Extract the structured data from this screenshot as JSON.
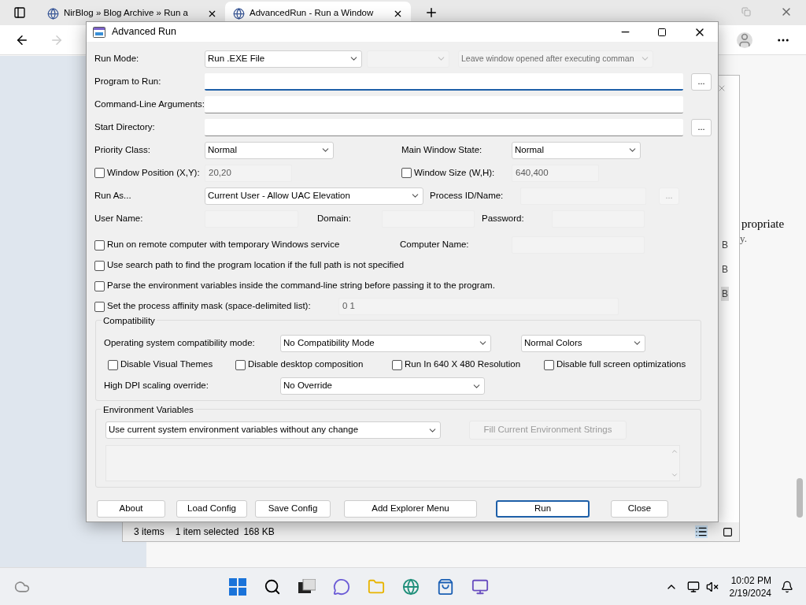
{
  "browser": {
    "tabs": [
      {
        "title": "NirBlog » Blog Archive » Run a",
        "selected": false
      },
      {
        "title": "AdvancedRun - Run a Window",
        "selected": true
      }
    ]
  },
  "background_window": {
    "page_text": [
      "propriate",
      "y."
    ],
    "size_column": [
      "B",
      "B",
      "B"
    ],
    "status_bar": [
      "3 items",
      "1 item selected",
      "168 KB"
    ]
  },
  "dialog": {
    "title": "Advanced Run",
    "run_mode": {
      "label": "Run Mode:",
      "value": "Run .EXE File",
      "disabled": false
    },
    "run_mode_extra": {
      "disabled": true
    },
    "leave_window": {
      "value": "Leave window opened after executing comman",
      "disabled": true
    },
    "program": {
      "label": "Program to Run:",
      "focused": true,
      "browse": "..."
    },
    "arguments": {
      "label": "Command-Line Arguments:",
      "focused": false
    },
    "start_directory": {
      "label": "Start Directory:",
      "focused": false,
      "browse": "..."
    },
    "priority": {
      "label": "Priority Class:",
      "value": "Normal",
      "disabled": false
    },
    "main_window_state": {
      "label": "Main Window State:",
      "value": "Normal",
      "disabled": false
    },
    "window_position": {
      "label": "Window Position (X,Y):",
      "checked": false,
      "value": "20,20",
      "disabled": true
    },
    "window_size": {
      "label": "Window Size (W,H):",
      "checked": false,
      "value": "640,400",
      "disabled": true
    },
    "run_as": {
      "label": "Run As...",
      "value": "Current User - Allow UAC Elevation",
      "disabled": false
    },
    "process": {
      "label": "Process ID/Name:",
      "disabled": true,
      "browse": "..."
    },
    "user_name": {
      "label": "User Name:",
      "disabled": true
    },
    "domain": {
      "label": "Domain:",
      "disabled": true
    },
    "password": {
      "label": "Password:",
      "disabled": true
    },
    "remote": {
      "label": "Run on remote computer with temporary Windows service",
      "checked": false
    },
    "computer_name": {
      "label": "Computer Name:",
      "disabled": true
    },
    "search_path": {
      "label": "Use search path to find the program location if the full path is not specified",
      "checked": false
    },
    "parse_env": {
      "label": "Parse the environment variables inside the command-line string before passing it to the program.",
      "checked": false
    },
    "affinity": {
      "label": "Set the process affinity mask (space-delimited list):",
      "checked": false,
      "value": "0 1",
      "disabled": true
    },
    "compatibility": {
      "title": "Compatibility",
      "os_mode": {
        "label": "Operating system compatibility mode:",
        "value": "No Compatibility Mode",
        "disabled": false
      },
      "colors": {
        "value": "Normal Colors",
        "disabled": false
      },
      "options": [
        {
          "label": "Disable Visual Themes",
          "checked": false
        },
        {
          "label": "Disable desktop composition",
          "checked": false
        },
        {
          "label": "Run In 640 X 480 Resolution",
          "checked": false
        },
        {
          "label": "Disable full screen optimizations",
          "checked": false
        }
      ],
      "dpi": {
        "label": "High DPI scaling override:",
        "value": "No Override",
        "disabled": false
      }
    },
    "environment": {
      "title": "Environment Variables",
      "mode": {
        "value": "Use current system environment variables without any change",
        "disabled": false
      },
      "fill_button": {
        "label": "Fill Current Environment Strings",
        "disabled": true
      }
    },
    "buttons": [
      {
        "label": "About",
        "default": false
      },
      {
        "label": "Load Config",
        "default": false
      },
      {
        "label": "Save Config",
        "default": false
      },
      {
        "label": "Add Explorer Menu",
        "default": false
      },
      {
        "label": "Run",
        "default": true
      },
      {
        "label": "Close",
        "default": false
      }
    ]
  },
  "taskbar": {
    "time": "10:02 PM",
    "date": "2/19/2024"
  }
}
